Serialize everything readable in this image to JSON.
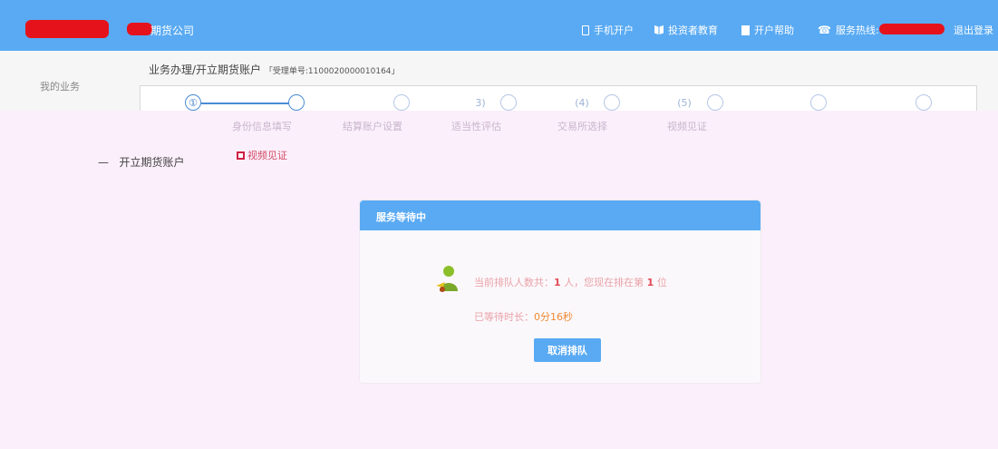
{
  "header": {
    "company_suffix": "期货公司",
    "nav": [
      {
        "icon": "phone-icon",
        "label": "手机开户"
      },
      {
        "icon": "book-icon",
        "label": "投资者教育"
      },
      {
        "icon": "note-icon",
        "label": "开户帮助"
      },
      {
        "icon": "telephone-icon",
        "label": "服务热线:"
      }
    ],
    "logout": "退出登录",
    "bar_color": "#59aaf3",
    "redaction_color": "#e6121b"
  },
  "breadcrumb": {
    "path": "业务办理/开立期货账户",
    "ticket": "「受理单号:1100020000010164」"
  },
  "sidebar": {
    "title": "我的业务",
    "active_item": "开立期货账户",
    "active_prefix": "—"
  },
  "steps": [
    {
      "number": "①",
      "label": "身份信息填写"
    },
    {
      "number": "",
      "label": "结算账户设置"
    },
    {
      "number": "3)",
      "label": "适当性评估"
    },
    {
      "number": "(4)",
      "label": "交易所选择"
    },
    {
      "number": "(5)",
      "label": "视频见证"
    }
  ],
  "current_step_tag": "视频见证",
  "modal": {
    "title": "服务等待中",
    "queue_prefix": "当前排队人数共：",
    "queue_count": "1",
    "queue_mid": "人，您现在排在第",
    "queue_position": "1",
    "queue_suffix": "位",
    "wait_label": "已等待时长：",
    "wait_time": "0分16秒",
    "cancel_label": "取消排队"
  }
}
